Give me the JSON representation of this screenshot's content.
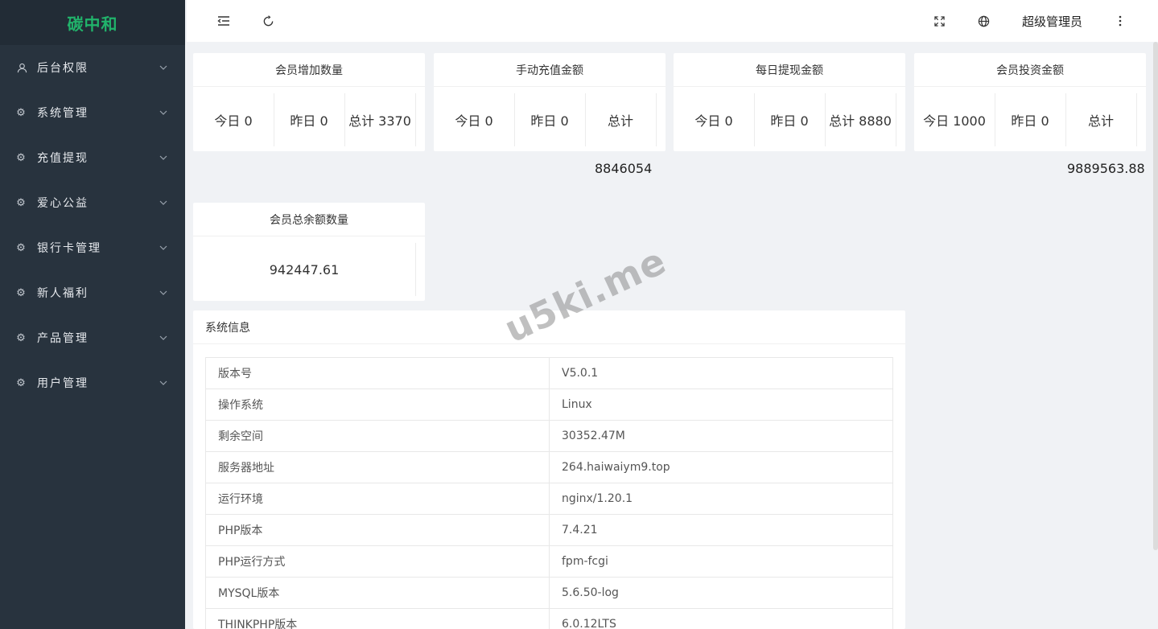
{
  "app": {
    "logo": "碳中和"
  },
  "sidebar": {
    "items": [
      {
        "label": "后台权限",
        "icon": "user-icon"
      },
      {
        "label": "系统管理",
        "icon": "gear-icon"
      },
      {
        "label": "充值提现",
        "icon": "gear-icon"
      },
      {
        "label": "爱心公益",
        "icon": "gear-icon"
      },
      {
        "label": "银行卡管理",
        "icon": "gear-icon"
      },
      {
        "label": "新人福利",
        "icon": "gear-icon"
      },
      {
        "label": "产品管理",
        "icon": "gear-icon"
      },
      {
        "label": "用户管理",
        "icon": "gear-icon"
      }
    ]
  },
  "header": {
    "user": "超级管理员",
    "icons": [
      "menu-fold-icon",
      "refresh-icon",
      "fullscreen-icon",
      "globe-icon",
      "more-vertical-icon"
    ]
  },
  "stats": [
    {
      "title": "会员增加数量",
      "today": "今日 0",
      "yesterday": "昨日 0",
      "total": "总计 3370",
      "total_overflow": ""
    },
    {
      "title": "手动充值金额",
      "today": "今日 0",
      "yesterday": "昨日 0",
      "total": "总计",
      "total_overflow": "8846054"
    },
    {
      "title": "每日提现金额",
      "today": "今日 0",
      "yesterday": "昨日 0",
      "total": "总计 8880",
      "total_overflow": ""
    },
    {
      "title": "会员投资金额",
      "today": "今日 1000",
      "yesterday": "昨日 0",
      "total": "总计",
      "total_overflow": "9889563.88"
    }
  ],
  "balance": {
    "title": "会员总余额数量",
    "value": "942447.61"
  },
  "system_info": {
    "title": "系统信息",
    "rows": [
      {
        "key": "版本号",
        "value": "V5.0.1"
      },
      {
        "key": "操作系统",
        "value": "Linux"
      },
      {
        "key": "剩余空间",
        "value": "30352.47M"
      },
      {
        "key": "服务器地址",
        "value": "264.haiwaiym9.top"
      },
      {
        "key": "运行环境",
        "value": "nginx/1.20.1"
      },
      {
        "key": "PHP版本",
        "value": "7.4.21"
      },
      {
        "key": "PHP运行方式",
        "value": "fpm-fcgi"
      },
      {
        "key": "MYSQL版本",
        "value": "5.6.50-log"
      },
      {
        "key": "THINKPHP版本",
        "value": "6.0.12LTS"
      }
    ]
  },
  "watermark": "u5ki.me"
}
